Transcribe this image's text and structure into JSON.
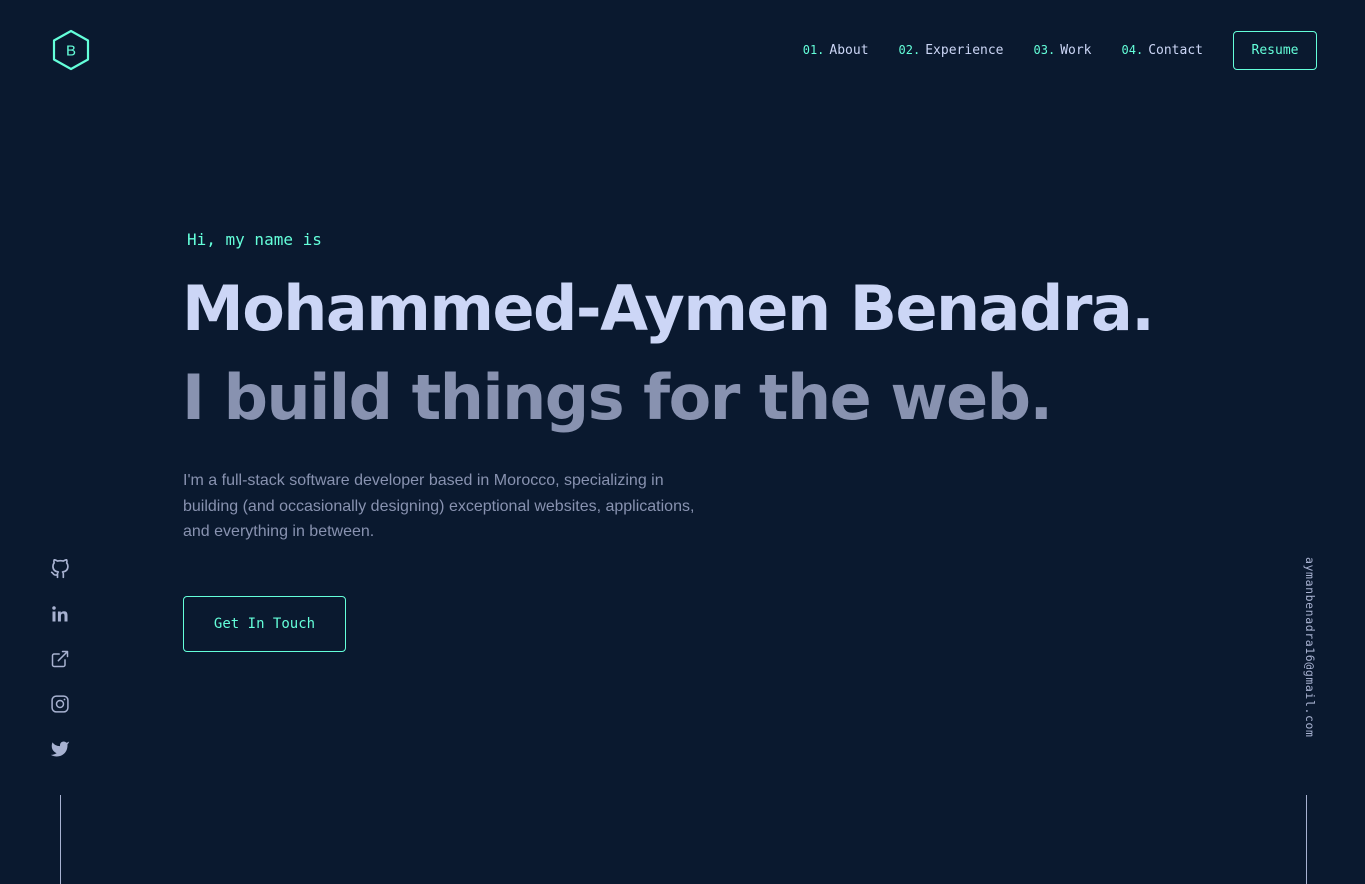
{
  "brand": {
    "logo_letter": "B"
  },
  "nav": {
    "items": [
      {
        "number": "01.",
        "label": "About"
      },
      {
        "number": "02.",
        "label": "Experience"
      },
      {
        "number": "03.",
        "label": "Work"
      },
      {
        "number": "04.",
        "label": "Contact"
      }
    ],
    "resume_label": "Resume"
  },
  "hero": {
    "greeting": "Hi, my name is",
    "name": "Mohammed-Aymen Benadra.",
    "tagline": "I build things for the web.",
    "description": "I'm a full-stack software developer based in Morocco, specializing in building (and occasionally designing) exceptional websites, applications, and everything in between.",
    "cta_label": "Get In Touch"
  },
  "social": {
    "icons": [
      "github-icon",
      "linkedin-icon",
      "external-link-icon",
      "instagram-icon",
      "twitter-icon"
    ]
  },
  "email": "aymanbenadra16@gmail.com",
  "colors": {
    "background": "#0a192f",
    "accent": "#64ffda",
    "heading": "#ccd6f6",
    "muted": "#8892b0",
    "light": "#a8b2d1"
  }
}
